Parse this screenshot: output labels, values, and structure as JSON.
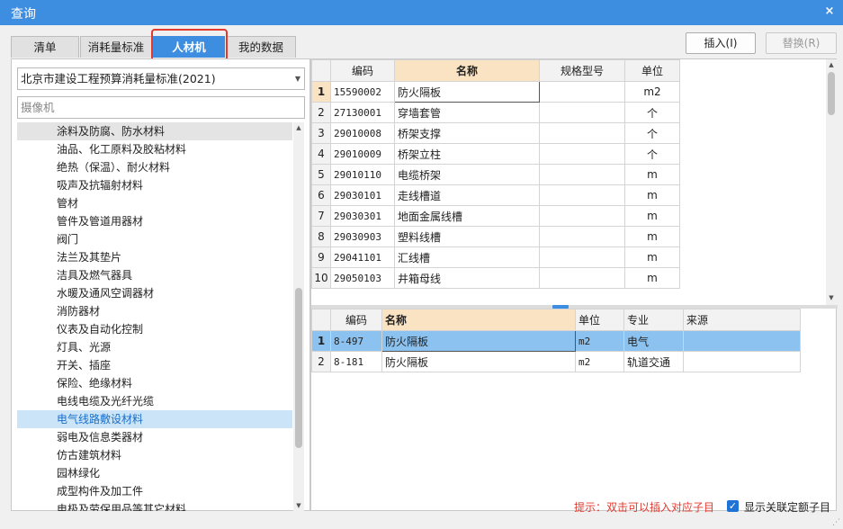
{
  "window": {
    "title": "查询"
  },
  "tabs": [
    {
      "label": "清单"
    },
    {
      "label": "消耗量标准"
    },
    {
      "label": "人材机"
    },
    {
      "label": "我的数据"
    }
  ],
  "toolbar": {
    "insert_label": "插入(I)",
    "replace_label": "替换(R)"
  },
  "left": {
    "standard_value": "北京市建设工程预算消耗量标准(2021)",
    "search_value": "摄像机",
    "categories": [
      "涂料及防腐、防水材料",
      "油品、化工原料及胶粘材料",
      "绝热（保温）、耐火材料",
      "吸声及抗辐射材料",
      "管材",
      "管件及管道用器材",
      "阀门",
      "法兰及其垫片",
      "洁具及燃气器具",
      "水暖及通风空调器材",
      "消防器材",
      "仪表及自动化控制",
      "灯具、光源",
      "开关、插座",
      "保险、绝缘材料",
      "电线电缆及光纤光缆",
      "电气线路敷设材料",
      "弱电及信息类器材",
      "仿古建筑材料",
      "园林绿化",
      "成型构件及加工件",
      "电极及劳保用品等其它材料"
    ],
    "selected_category": "电气线路敷设材料"
  },
  "top_grid": {
    "headers": [
      "编码",
      "名称",
      "规格型号",
      "单位"
    ],
    "rows": [
      {
        "no": "1",
        "code": "15590002",
        "name": "防火隔板",
        "spec": "",
        "unit": "m2"
      },
      {
        "no": "2",
        "code": "27130001",
        "name": "穿墙套管",
        "spec": "",
        "unit": "个"
      },
      {
        "no": "3",
        "code": "29010008",
        "name": "桥架支撑",
        "spec": "",
        "unit": "个"
      },
      {
        "no": "4",
        "code": "29010009",
        "name": "桥架立柱",
        "spec": "",
        "unit": "个"
      },
      {
        "no": "5",
        "code": "29010110",
        "name": "电缆桥架",
        "spec": "",
        "unit": "m"
      },
      {
        "no": "6",
        "code": "29030101",
        "name": "走线槽道",
        "spec": "",
        "unit": "m"
      },
      {
        "no": "7",
        "code": "29030301",
        "name": "地面金属线槽",
        "spec": "",
        "unit": "m"
      },
      {
        "no": "8",
        "code": "29030903",
        "name": "塑料线槽",
        "spec": "",
        "unit": "m"
      },
      {
        "no": "9",
        "code": "29041101",
        "name": "汇线槽",
        "spec": "",
        "unit": "m"
      },
      {
        "no": "10",
        "code": "29050103",
        "name": "井箱母线",
        "spec": "",
        "unit": "m"
      }
    ]
  },
  "bottom_grid": {
    "headers": [
      "编码",
      "名称",
      "单位",
      "专业",
      "来源"
    ],
    "rows": [
      {
        "no": "1",
        "code": "8-497",
        "name": "防火隔板",
        "unit": "m2",
        "major": "电气",
        "source": ""
      },
      {
        "no": "2",
        "code": "8-181",
        "name": "防火隔板",
        "unit": "m2",
        "major": "轨道交通",
        "source": ""
      }
    ]
  },
  "footer": {
    "hint": "提示：双击可以插入对应子目",
    "show_linked_label": "显示关联定额子目",
    "show_linked_checked": true
  }
}
